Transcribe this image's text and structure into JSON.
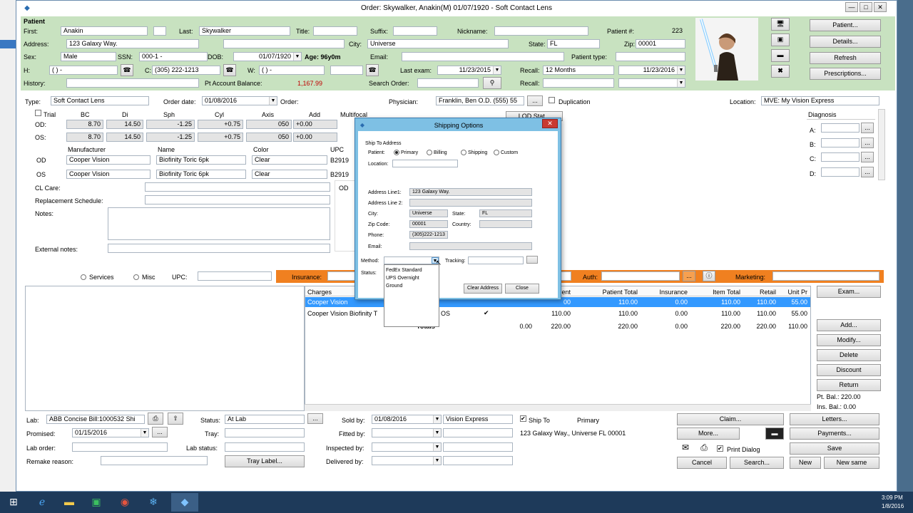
{
  "titlebar": {
    "title": "Order: Skywalker, Anakin(M) 01/07/1920 - Soft Contact Lens",
    "min": "—",
    "max": "□",
    "close": "✕"
  },
  "patient": {
    "section": "Patient",
    "first_label": "First:",
    "first": "Anakin",
    "last_label": "Last:",
    "last": "Skywalker",
    "title_label": "Title:",
    "suffix_label": "Suffix:",
    "nickname_label": "Nickname:",
    "patient_no_label": "Patient #:",
    "patient_no": "223",
    "address_label": "Address:",
    "address": "123 Galaxy Way.",
    "city_label": "City:",
    "city": "Universe",
    "state_label": "State:",
    "state": "FL",
    "zip_label": "Zip:",
    "zip": "00001",
    "sex_label": "Sex:",
    "sex": "Male",
    "ssn_label": "SSN:",
    "ssn": "000-1 -",
    "dob_label": "DOB:",
    "dob": "01/07/1920",
    "age": "Age: 96y0m",
    "email_label": "Email:",
    "patient_type_label": "Patient type:",
    "h_label": "H:",
    "h_phone": "(   )    -",
    "c_label": "C:",
    "c_phone": "(305) 222-1213",
    "w_label": "W:",
    "w_phone": "(   )    -",
    "last_exam_label": "Last exam:",
    "last_exam": "11/23/2015",
    "recall_label": "Recall:",
    "recall": "12 Months",
    "recall_date": "11/23/2016",
    "history_label": "History:",
    "balance_label": "Pt Account Balance:",
    "balance": "1,167.99",
    "search_order_label": "Search Order:",
    "recall2_label": "Recall:"
  },
  "side_buttons": [
    "Patient...",
    "Details...",
    "Refresh",
    "Prescriptions..."
  ],
  "order": {
    "type_label": "Type:",
    "type": "Soft Contact Lens",
    "order_date_label": "Order date:",
    "order_date": "01/08/2016",
    "order_label": "Order:",
    "physician_label": "Physician:",
    "physician": "Franklin, Ben O.D. (555) 55",
    "duplication_label": "Duplication",
    "location_label": "Location:",
    "location": "MVE: My Vision Express",
    "trial_label": "Trial",
    "headers": [
      "BC",
      "Di",
      "Sph",
      "Cyl",
      "Axis",
      "Add",
      "Multifocal"
    ],
    "od_label": "OD:",
    "os_label": "OS:",
    "od": [
      "8.70",
      "14.50",
      "-1.25",
      "+0.75",
      "050",
      "+0.00"
    ],
    "os": [
      "8.70",
      "14.50",
      "-1.25",
      "+0.75",
      "050",
      "+0.00"
    ],
    "lod_button": "LOD Stat...",
    "mfr_label": "Manufacturer",
    "name_label": "Name",
    "color_label": "Color",
    "upc_label": "UPC",
    "od2_label": "OD",
    "os2_label": "OS",
    "od_mfr": "Cooper Vision",
    "od_name": "Biofinity Toric 6pk",
    "od_color": "Clear",
    "od_upc": "B2919",
    "os_mfr": "Cooper Vision",
    "os_name": "Biofinity Toric 6pk",
    "os_color": "Clear",
    "os_upc": "B2919",
    "cl_care_label": "CL Care:",
    "replacement_label": "Replacement Schedule:",
    "notes_label": "Notes:",
    "external_notes_label": "External notes:",
    "od_trunc_label": "OD"
  },
  "diagnosis": {
    "title": "Diagnosis",
    "rows": [
      "A:",
      "B:",
      "C:",
      "D:"
    ],
    "btn": "..."
  },
  "billing_bar": {
    "services_label": "Services",
    "misc_label": "Misc",
    "upc_label": "UPC:",
    "insurance_label": "Insurance:",
    "auth_label": "Auth:",
    "marketing_label": "Marketing:"
  },
  "charges": {
    "headers": [
      "Charges",
      "ent",
      "Patient Total",
      "Insurance",
      "Item Total",
      "Retail",
      "Unit Pr"
    ],
    "rows": [
      {
        "desc": "Cooper Vision",
        "ent": "00",
        "pt_total": "110.00",
        "ins": "0.00",
        "item_total": "110.00",
        "retail": "110.00",
        "unit": "55.00"
      },
      {
        "desc": "Cooper Vision Biofinity T",
        "extra": "OS",
        "ent": "110.00",
        "pt_total": "110.00",
        "ins": "0.00",
        "item_total": "110.00",
        "retail": "110.00",
        "unit": "55.00"
      }
    ],
    "totals_label": "Totals",
    "totals": {
      "a": "0.00",
      "b": "220.00",
      "c": "220.00",
      "d": "0.00",
      "e": "220.00",
      "f": "220.00",
      "g": "110.00"
    }
  },
  "right_buttons": [
    "Exam...",
    "Add...",
    "Modify...",
    "Delete",
    "Discount",
    "Return"
  ],
  "balances": {
    "pt_bal": "Pt. Bal.: 220.00",
    "ins_bal": "Ins. Bal.: 0.00"
  },
  "bottom": {
    "lab_label": "Lab:",
    "lab": "ABB Concise Bill:1000532 Shi",
    "status_label": "Status:",
    "status": "At Lab",
    "sold_by_label": "Sold by:",
    "sold_by": "01/08/2016",
    "sold_by_loc": "Vision Express",
    "ship_to_label": "Ship To",
    "ship_to_type": "Primary",
    "ship_to_address": "123 Galaxy Way., Universe FL 00001",
    "promised_label": "Promised:",
    "promised": "01/15/2016",
    "tray_label": "Tray:",
    "fitted_by_label": "Fitted by:",
    "lab_order_label": "Lab order:",
    "lab_status_label": "Lab status:",
    "inspected_by_label": "Inspected by:",
    "remake_label": "Remake reason:",
    "tray_button": "Tray Label...",
    "delivered_by_label": "Delivered by:",
    "print_dialog_label": "Print Dialog"
  },
  "bottom_buttons": {
    "claim": "Claim...",
    "letters": "Letters...",
    "more": "More...",
    "payments": "Payments...",
    "save": "Save",
    "cancel": "Cancel",
    "search": "Search...",
    "new": "New",
    "new_same": "New same"
  },
  "dialog": {
    "title": "Shipping Options",
    "ship_to": "Ship To Address",
    "patient_label": "Patient:",
    "options": [
      "Primary",
      "Billing",
      "Shipping",
      "Custom"
    ],
    "location_label": "Location:",
    "addr1_label": "Address Line1:",
    "addr1": "123 Galaxy Way.",
    "addr2_label": "Address Line 2:",
    "city_label": "City:",
    "city": "Universe",
    "state_label": "State:",
    "state": "FL",
    "zip_label": "Zip Code:",
    "zip": "00001",
    "country_label": "Country:",
    "phone_label": "Phone:",
    "phone": "(305)222-1213",
    "email_label": "Email:",
    "method_label": "Method:",
    "tracking_label": "Tracking:",
    "status_label": "Status:",
    "methods": [
      "FedEx Standard",
      "UPS Overnight",
      "Ground"
    ],
    "clear_button": "Clear Address",
    "close_button": "Close"
  },
  "taskbar": {
    "time": "3:09 PM",
    "date": "1/8/2016"
  },
  "colors": {
    "header_green": "#c8e2c0",
    "orange": "#f08020",
    "selection": "#3399ff",
    "dialog_title": "#7ec0e4"
  }
}
